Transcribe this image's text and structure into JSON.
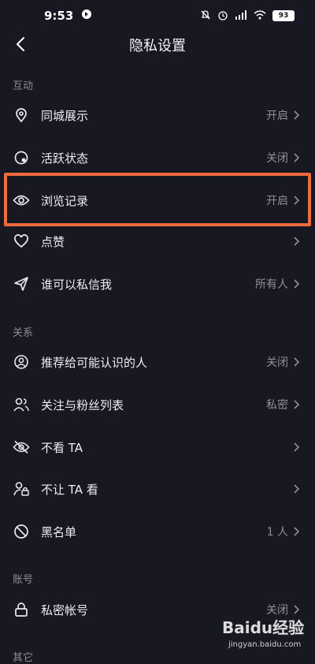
{
  "status": {
    "time": "9:53",
    "battery": "93"
  },
  "header": {
    "title": "隐私设置"
  },
  "sections": {
    "interaction": "互动",
    "relations": "关系",
    "account": "账号",
    "other": "其它"
  },
  "items": {
    "local": {
      "label": "同城展示",
      "value": "开启"
    },
    "active": {
      "label": "活跃状态",
      "value": "关闭"
    },
    "history": {
      "label": "浏览记录",
      "value": "开启"
    },
    "likes": {
      "label": "点赞",
      "value": ""
    },
    "dm": {
      "label": "谁可以私信我",
      "value": "所有人"
    },
    "recommend": {
      "label": "推荐给可能认识的人",
      "value": "关闭"
    },
    "follow": {
      "label": "关注与粉丝列表",
      "value": "私密"
    },
    "nosee": {
      "label": "不看 TA",
      "value": ""
    },
    "noshow": {
      "label": "不让 TA 看",
      "value": ""
    },
    "blacklist": {
      "label": "黑名单",
      "value": "1 人"
    },
    "private": {
      "label": "私密帐号",
      "value": "关闭"
    }
  },
  "watermark": {
    "brand": "Baidu经验",
    "url": "jingyan.baidu.com"
  },
  "colors": {
    "background": "#171821",
    "highlight": "#f06b3c"
  }
}
